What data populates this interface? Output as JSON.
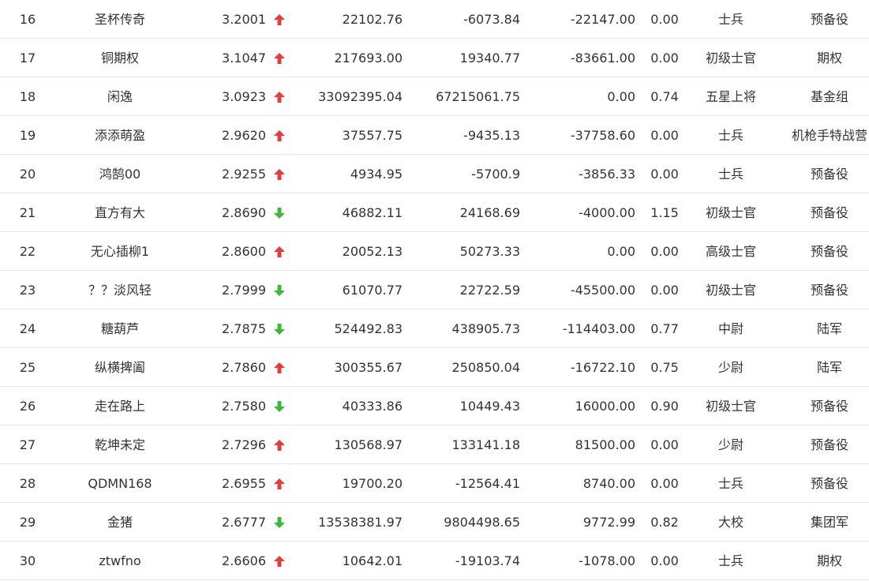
{
  "colors": {
    "up": "#e63b3b",
    "down": "#3cb93c",
    "text": "#333333"
  },
  "rows": [
    {
      "rank": "16",
      "name": "圣杯传奇",
      "score": "3.2001",
      "trend": "up",
      "v1": "22102.76",
      "v2": "-6073.84",
      "v3": "-22147.00",
      "ratio": "0.00",
      "level": "士兵",
      "group": "预备役"
    },
    {
      "rank": "17",
      "name": "铜期权",
      "score": "3.1047",
      "trend": "up",
      "v1": "217693.00",
      "v2": "19340.77",
      "v3": "-83661.00",
      "ratio": "0.00",
      "level": "初级士官",
      "group": "期权"
    },
    {
      "rank": "18",
      "name": "闲逸",
      "score": "3.0923",
      "trend": "up",
      "v1": "33092395.04",
      "v2": "67215061.75",
      "v3": "0.00",
      "ratio": "0.74",
      "level": "五星上将",
      "group": "基金组"
    },
    {
      "rank": "19",
      "name": "添添萌盈",
      "score": "2.9620",
      "trend": "up",
      "v1": "37557.75",
      "v2": "-9435.13",
      "v3": "-37758.60",
      "ratio": "0.00",
      "level": "士兵",
      "group": "机枪手特战营"
    },
    {
      "rank": "20",
      "name": "鸿鹄00",
      "score": "2.9255",
      "trend": "up",
      "v1": "4934.95",
      "v2": "-5700.9",
      "v3": "-3856.33",
      "ratio": "0.00",
      "level": "士兵",
      "group": "预备役"
    },
    {
      "rank": "21",
      "name": "直方有大",
      "score": "2.8690",
      "trend": "down",
      "v1": "46882.11",
      "v2": "24168.69",
      "v3": "-4000.00",
      "ratio": "1.15",
      "level": "初级士官",
      "group": "预备役"
    },
    {
      "rank": "22",
      "name": "无心插柳1",
      "score": "2.8600",
      "trend": "up",
      "v1": "20052.13",
      "v2": "50273.33",
      "v3": "0.00",
      "ratio": "0.00",
      "level": "高级士官",
      "group": "预备役"
    },
    {
      "rank": "23",
      "name": "？？淡风轻",
      "score": "2.7999",
      "trend": "down",
      "v1": "61070.77",
      "v2": "22722.59",
      "v3": "-45500.00",
      "ratio": "0.00",
      "level": "初级士官",
      "group": "预备役"
    },
    {
      "rank": "24",
      "name": "糖葫芦",
      "score": "2.7875",
      "trend": "down",
      "v1": "524492.83",
      "v2": "438905.73",
      "v3": "-114403.00",
      "ratio": "0.77",
      "level": "中尉",
      "group": "陆军"
    },
    {
      "rank": "25",
      "name": "纵横捭阖",
      "score": "2.7860",
      "trend": "up",
      "v1": "300355.67",
      "v2": "250850.04",
      "v3": "-16722.10",
      "ratio": "0.75",
      "level": "少尉",
      "group": "陆军"
    },
    {
      "rank": "26",
      "name": "走在路上",
      "score": "2.7580",
      "trend": "down",
      "v1": "40333.86",
      "v2": "10449.43",
      "v3": "16000.00",
      "ratio": "0.90",
      "level": "初级士官",
      "group": "预备役"
    },
    {
      "rank": "27",
      "name": "乾坤未定",
      "score": "2.7296",
      "trend": "up",
      "v1": "130568.97",
      "v2": "133141.18",
      "v3": "81500.00",
      "ratio": "0.00",
      "level": "少尉",
      "group": "预备役"
    },
    {
      "rank": "28",
      "name": "QDMN168",
      "score": "2.6955",
      "trend": "up",
      "v1": "19700.20",
      "v2": "-12564.41",
      "v3": "8740.00",
      "ratio": "0.00",
      "level": "士兵",
      "group": "预备役"
    },
    {
      "rank": "29",
      "name": "金猪",
      "score": "2.6777",
      "trend": "down",
      "v1": "13538381.97",
      "v2": "9804498.65",
      "v3": "9772.99",
      "ratio": "0.82",
      "level": "大校",
      "group": "集团军"
    },
    {
      "rank": "30",
      "name": "ztwfno",
      "score": "2.6606",
      "trend": "up",
      "v1": "10642.01",
      "v2": "-19103.74",
      "v3": "-1078.00",
      "ratio": "0.00",
      "level": "士兵",
      "group": "期权"
    }
  ]
}
